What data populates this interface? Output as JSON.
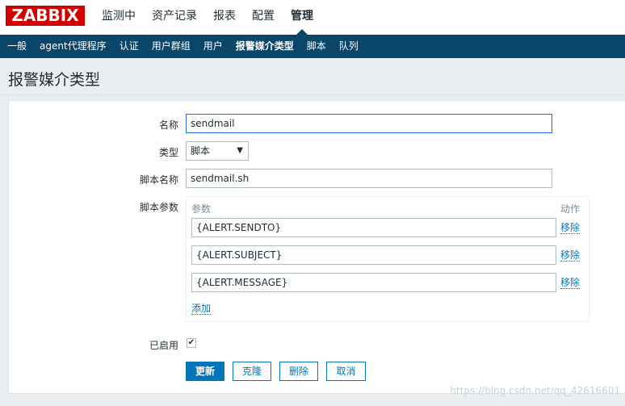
{
  "header": {
    "logo": "ZABBIX",
    "nav": [
      "监测中",
      "资产记录",
      "报表",
      "配置",
      "管理"
    ],
    "active_nav": "管理"
  },
  "subnav": {
    "items": [
      "一般",
      "agent代理程序",
      "认证",
      "用户群组",
      "用户",
      "报警媒介类型",
      "脚本",
      "队列"
    ],
    "active": "报警媒介类型"
  },
  "page": {
    "title": "报警媒介类型"
  },
  "form": {
    "name_label": "名称",
    "name_value": "sendmail",
    "type_label": "类型",
    "type_value": "脚本",
    "script_name_label": "脚本名称",
    "script_name_value": "sendmail.sh",
    "script_params_label": "脚本参数",
    "params_header": "参数",
    "action_header": "动作",
    "params": [
      {
        "value": "{ALERT.SENDTO}",
        "remove": "移除"
      },
      {
        "value": "{ALERT.SUBJECT}",
        "remove": "移除"
      },
      {
        "value": "{ALERT.MESSAGE}",
        "remove": "移除"
      }
    ],
    "add_link": "添加",
    "enabled_label": "已启用",
    "enabled": true
  },
  "buttons": {
    "update": "更新",
    "clone": "克隆",
    "delete": "删除",
    "cancel": "取消"
  },
  "watermark": "https://blog.csdn.net/qq_42616601",
  "colors": {
    "logo_bg": "#d40000",
    "subnav_bg": "#0a466a",
    "primary": "#0275b8"
  }
}
